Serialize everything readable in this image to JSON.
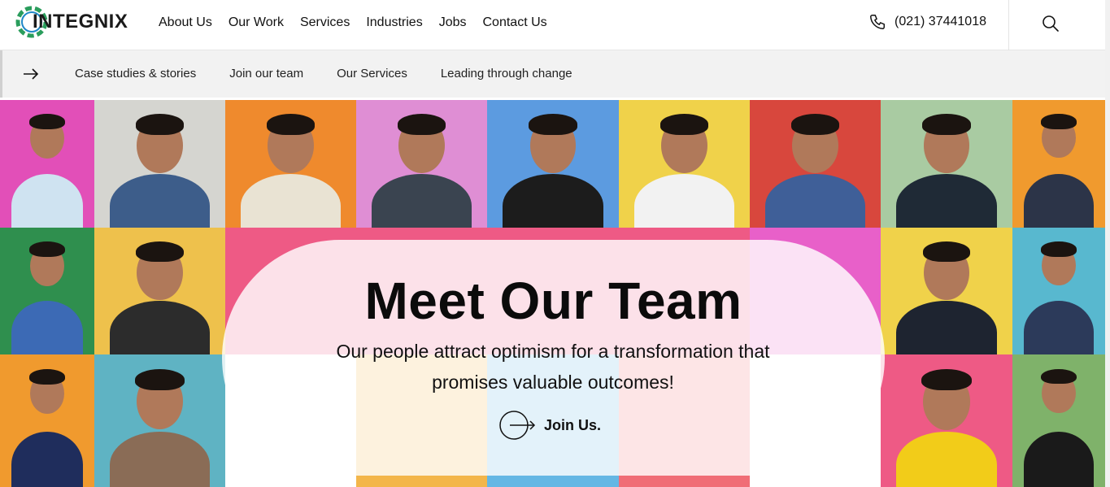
{
  "brand": {
    "logo_text": "INTEGNIX",
    "accent": "#2a9d5c",
    "accent2": "#1e88c7"
  },
  "nav": {
    "items": [
      {
        "label": "About Us"
      },
      {
        "label": "Our Work"
      },
      {
        "label": "Services"
      },
      {
        "label": "Industries"
      },
      {
        "label": "Jobs"
      },
      {
        "label": "Contact Us"
      }
    ]
  },
  "contact": {
    "phone": "(021) 37441018",
    "phone_icon": "phone-icon"
  },
  "search": {
    "icon": "search-icon"
  },
  "subnav": {
    "icon": "arrow-right-icon",
    "links": [
      {
        "label": "Case studies & stories"
      },
      {
        "label": "Join our team"
      },
      {
        "label": "Our Services"
      },
      {
        "label": "Leading through change"
      }
    ]
  },
  "hero": {
    "title": "Meet Our Team",
    "subtitle_line1": "Our people attract optimism for a transformation that",
    "subtitle_line2": "promises valuable outcomes!",
    "cta_label": "Join Us.",
    "cta_icon": "circle-arrow-icon"
  }
}
